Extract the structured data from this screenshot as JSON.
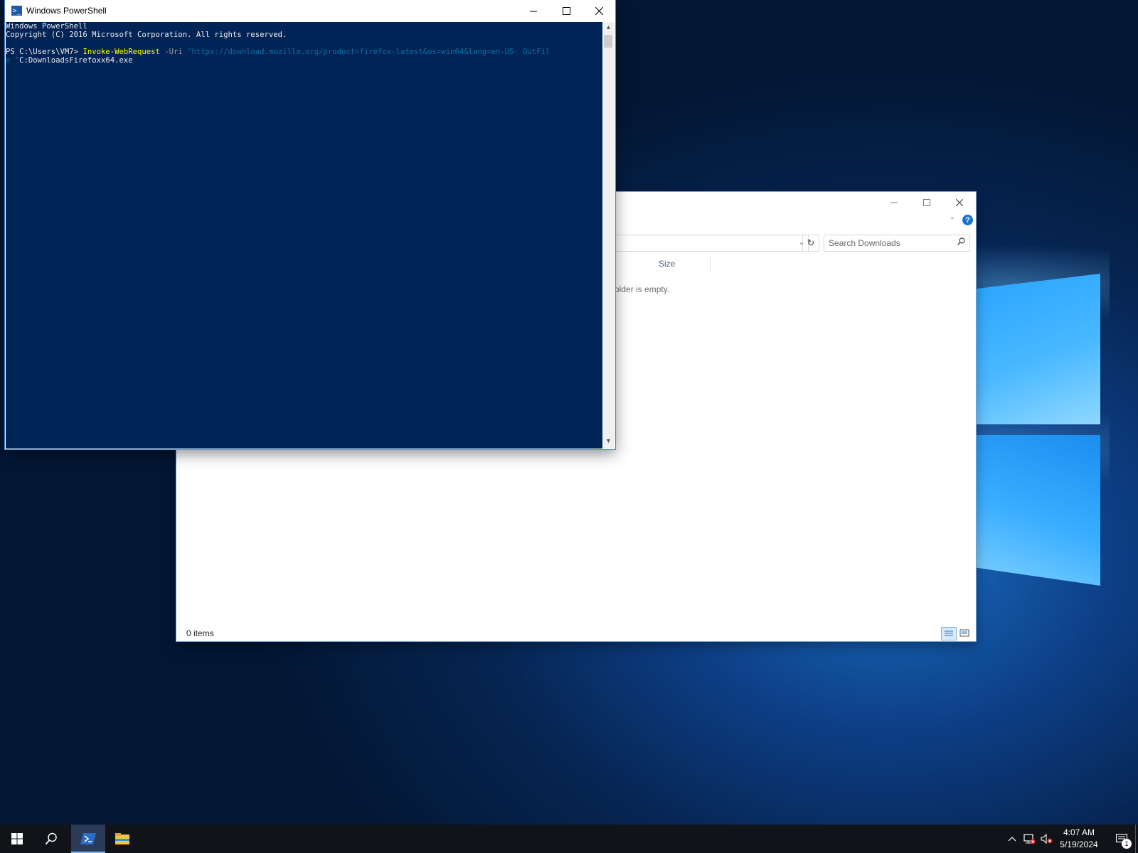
{
  "powershell": {
    "title": "Windows PowerShell",
    "console": {
      "banner_line1": "Windows PowerShell",
      "banner_line2": "Copyright (C) 2016 Microsoft Corporation. All rights reserved.",
      "prompt": "PS C:\\Users\\VM7> ",
      "cmdlet": "Invoke-WebRequest",
      "param_uri": " -Uri ",
      "uri_value": "\"https://download.mozilla.org/product=firefox-latest&os=win64&lang=en-US- OutFil",
      "wrap_prefix": "e \"",
      "wrap_rest": "C:DownloadsFirefoxx64.exe"
    }
  },
  "explorer": {
    "search_placeholder": "Search Downloads",
    "column_size": "Size",
    "empty_message": "older is empty.",
    "status_items": "0 items"
  },
  "taskbar": {
    "time": "4:07 AM",
    "date": "5/19/2024",
    "notification_count": "1"
  },
  "icons": {
    "start": "windows-logo-icon",
    "search": "search-icon",
    "powershell": "powershell-icon",
    "explorer": "folder-icon"
  },
  "colors": {
    "console_bg": "#012456",
    "console_fg": "#eeedf0",
    "cmdlet": "#ffff00",
    "string": "#0b6fa3",
    "accent": "#1a73d1"
  }
}
